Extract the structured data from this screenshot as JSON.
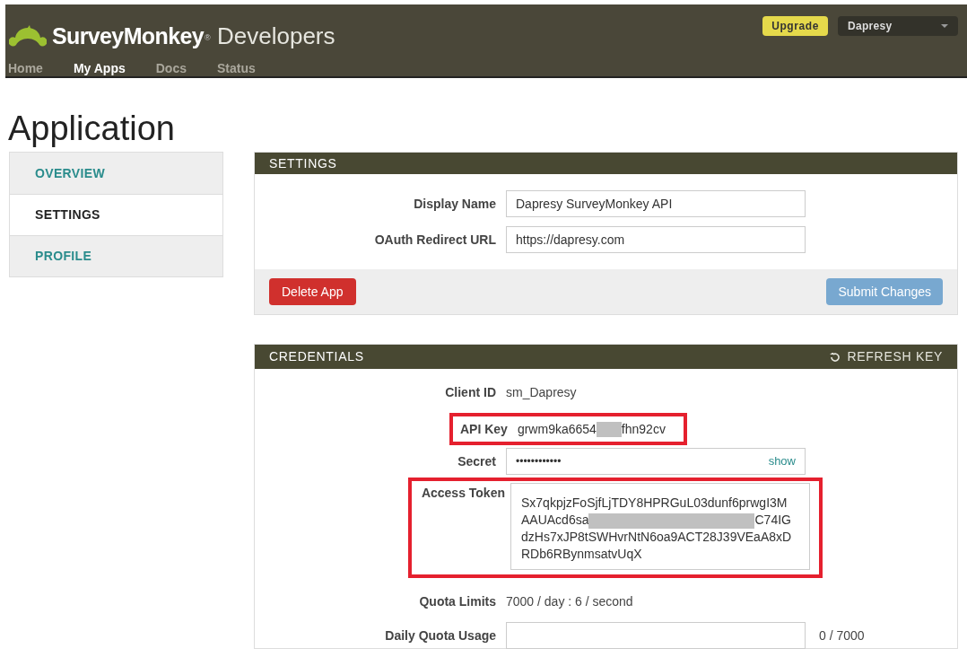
{
  "header": {
    "brand": "SurveyMonkey",
    "brand_mark": "®",
    "product": "Developers",
    "nav": [
      {
        "label": "Home",
        "selected": false
      },
      {
        "label": "My Apps",
        "selected": true
      },
      {
        "label": "Docs",
        "selected": false
      },
      {
        "label": "Status",
        "selected": false
      }
    ],
    "upgrade_button": "Upgrade",
    "account_menu": "Dapresy"
  },
  "page_title": "Application",
  "sidebar": {
    "items": [
      {
        "label": "OVERVIEW",
        "selected": false
      },
      {
        "label": "SETTINGS",
        "selected": true
      },
      {
        "label": "PROFILE",
        "selected": false
      }
    ]
  },
  "settings": {
    "title": "SETTINGS",
    "fields": [
      {
        "label": "Display Name",
        "value": "Dapresy SurveyMonkey API"
      },
      {
        "label": "OAuth Redirect URL",
        "value": "https://dapresy.com"
      }
    ],
    "delete_button": "Delete App",
    "submit_button": "Submit Changes"
  },
  "credentials": {
    "title": "CREDENTIALS",
    "refresh": "REFRESH KEY",
    "client_id": {
      "label": "Client ID",
      "value": "sm_Dapresy"
    },
    "api_key": {
      "label": "API Key",
      "before": "grwm9ka6654",
      "after": "fhn92cv",
      "highlighted": true
    },
    "secret": {
      "label": "Secret",
      "value": "••••••••••••",
      "show": "show"
    },
    "access_token": {
      "label": "Access Token",
      "highlighted": true,
      "lines": [
        {
          "before": "Sx7qkpjzFoSjfLjTDY8HPRGuL03dunf6prwgI3M"
        },
        {
          "before": "AAUAcd6sa",
          "after": "C74IG"
        },
        {
          "before": "dzHs7xJP8tSWHvrNtN6oa9ACT28J39VEaA8xD"
        },
        {
          "before": "RDb6RBynmsatvUqX"
        }
      ]
    },
    "quota_limits": {
      "label": "Quota Limits",
      "value": "7000 / day : 6 / second"
    },
    "daily_quota": {
      "label": "Daily Quota Usage",
      "reading": "0 / 7000"
    }
  }
}
